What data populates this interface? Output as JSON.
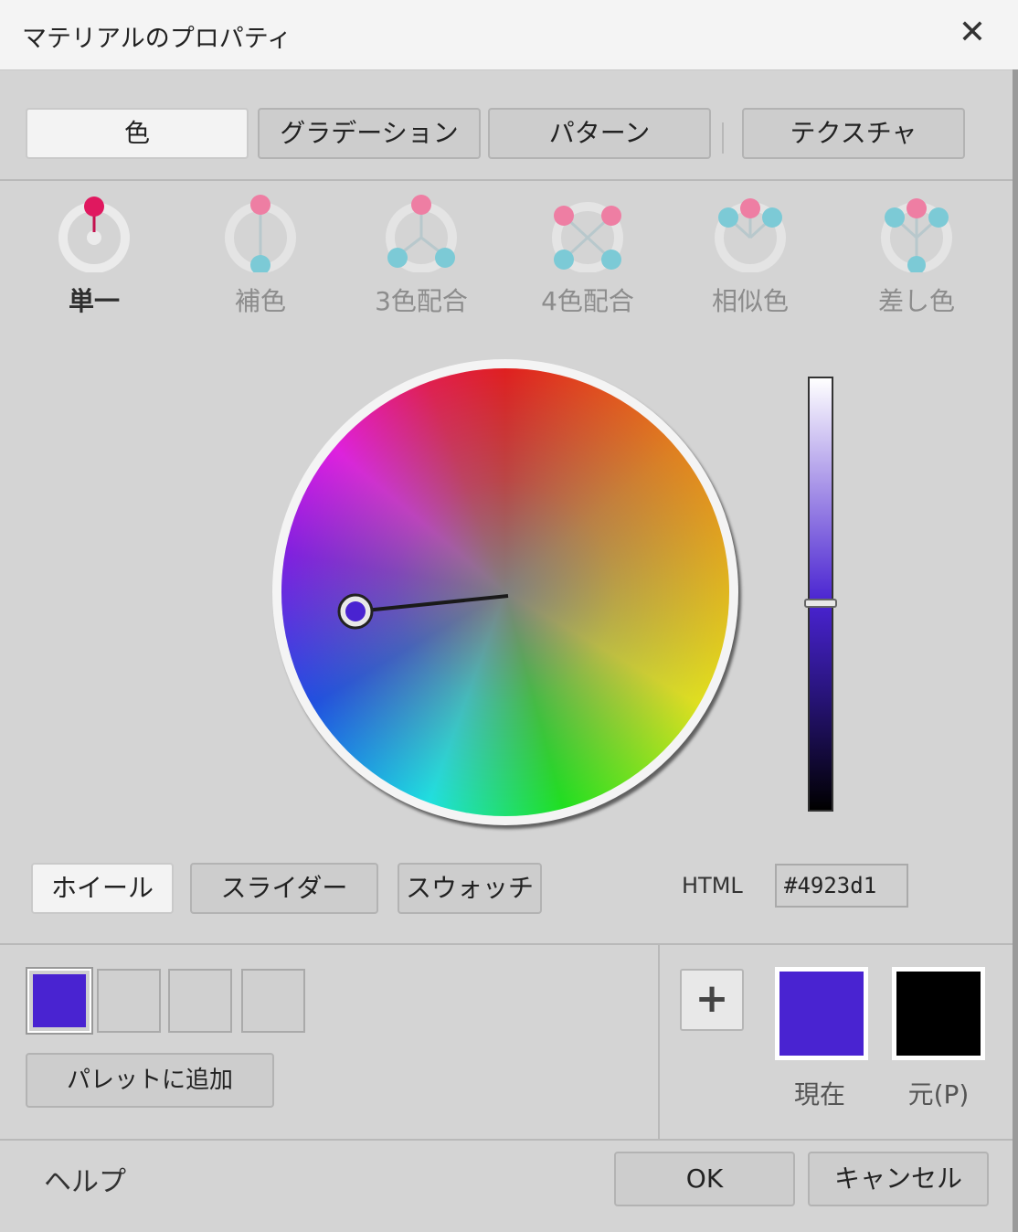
{
  "window": {
    "title": "マテリアルのプロパティ",
    "close_glyph": "✕"
  },
  "top_tabs": [
    {
      "label": "色",
      "active": true
    },
    {
      "label": "グラデーション",
      "active": false
    },
    {
      "label": "パターン",
      "active": false
    },
    {
      "label": "テクスチャ",
      "active": false
    }
  ],
  "schemes": [
    {
      "label": "単一",
      "selected": true
    },
    {
      "label": "補色",
      "selected": false
    },
    {
      "label": "3色配合",
      "selected": false
    },
    {
      "label": "4色配合",
      "selected": false
    },
    {
      "label": "相似色",
      "selected": false
    },
    {
      "label": "差し色",
      "selected": false
    }
  ],
  "picker": {
    "current_color": "#4923d1",
    "brightness_level": 0.52
  },
  "mode_tabs": [
    {
      "label": "ホイール",
      "active": true
    },
    {
      "label": "スライダー",
      "active": false
    },
    {
      "label": "スウォッチ",
      "active": false
    }
  ],
  "html_field": {
    "label": "HTML",
    "value": "#4923d1"
  },
  "palette": {
    "slots": [
      "#4923d1",
      "",
      "",
      ""
    ],
    "add_button_label": "パレットに追加"
  },
  "colors": {
    "plus_glyph": "+",
    "current": {
      "label": "現在",
      "color": "#4923d1"
    },
    "original": {
      "label": "元(P)",
      "color": "#000000"
    }
  },
  "footer": {
    "help_label": "ヘルプ",
    "ok_label": "OK",
    "cancel_label": "キャンセル"
  }
}
